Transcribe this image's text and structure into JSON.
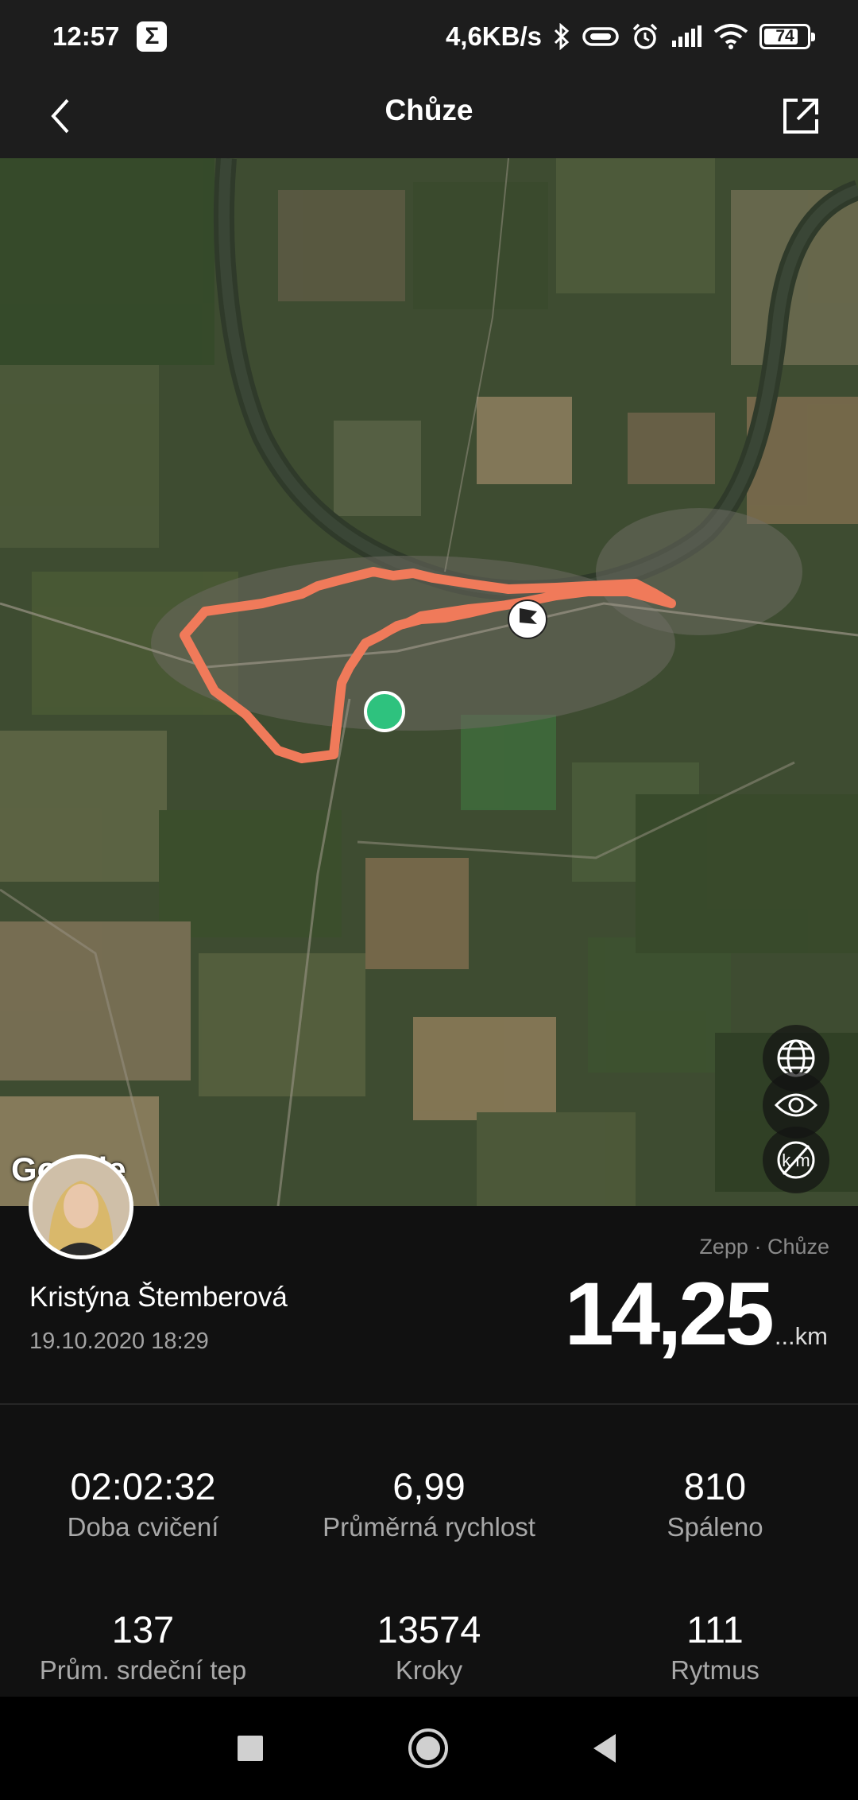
{
  "status_bar": {
    "time": "12:57",
    "notification_icon": "sigma-icon",
    "network_speed": "4,6KB/s",
    "battery_level": "74"
  },
  "app_bar": {
    "title": "Chůze",
    "back_icon": "chevron-left-icon",
    "share_icon": "share-icon"
  },
  "map": {
    "attribution": "Google",
    "route_color": "#f07a5a",
    "start_marker_color": "#2ec27e",
    "buttons": [
      {
        "name": "map-layer-button",
        "icon": "globe-icon"
      },
      {
        "name": "km-markers-toggle",
        "icon": "km-off-icon"
      },
      {
        "name": "view-toggle",
        "icon": "eye-icon"
      }
    ]
  },
  "workout": {
    "source": "Zepp · Chůze",
    "user_name": "Kristýna Štemberová",
    "date": "19.10.2020 18:29",
    "distance": "14,25",
    "distance_unit": "...km"
  },
  "stats": [
    {
      "value": "02:02:32",
      "label": "Doba cvičení"
    },
    {
      "value": "6,99",
      "label": "Průměrná rychlost"
    },
    {
      "value": "810",
      "label": "Spáleno"
    },
    {
      "value": "137",
      "label": "Prům. srdeční tep"
    },
    {
      "value": "13574",
      "label": "Kroky"
    },
    {
      "value": "111",
      "label": "Rytmus"
    }
  ],
  "nav_bar": {
    "recent_icon": "square-icon",
    "home_icon": "circle-icon",
    "back_icon": "triangle-back-icon"
  }
}
